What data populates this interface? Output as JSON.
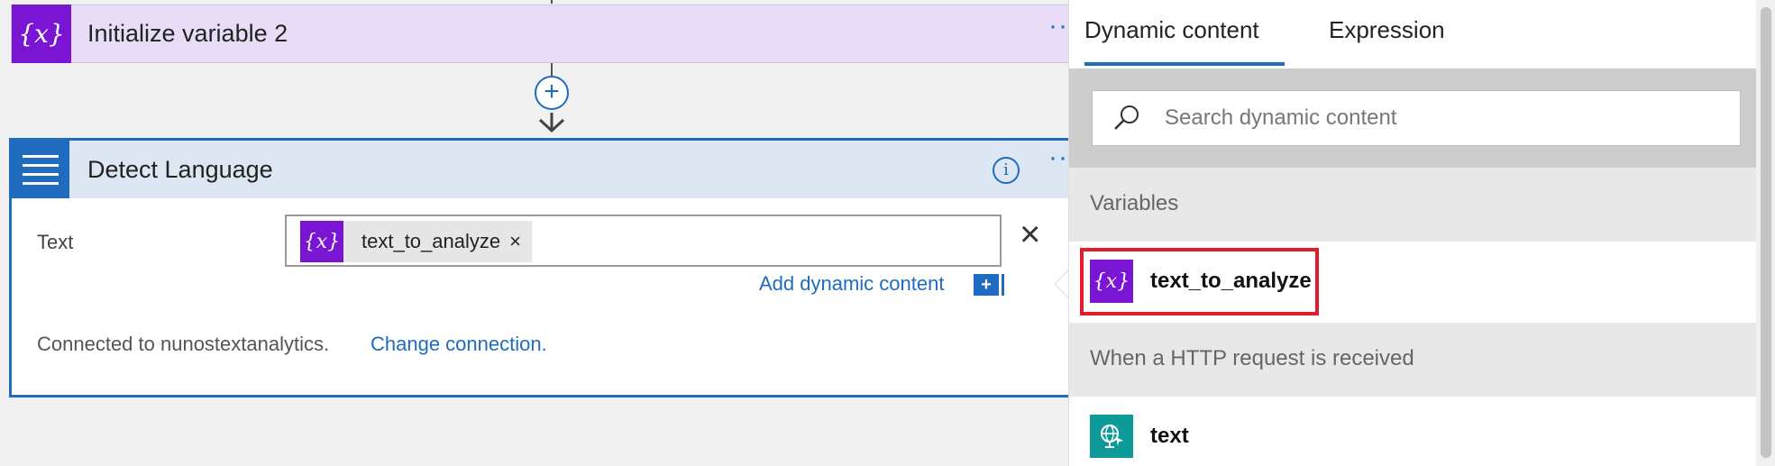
{
  "flow": {
    "init_card": {
      "title": "Initialize variable 2",
      "icon_glyph": "{x}",
      "icon": "variable-icon",
      "color": "#7a16d3"
    },
    "add_step_glyph": "+",
    "detect_card": {
      "title": "Detect Language",
      "icon": "text-analytics-icon",
      "color": "#1f6bbf",
      "info_glyph": "i",
      "more_glyph": "···",
      "text_label": "Text",
      "token": {
        "icon_glyph": "{x}",
        "label": "text_to_analyze",
        "remove_glyph": "×"
      },
      "clear_glyph": "×",
      "add_dynamic_label": "Add dynamic content",
      "add_dynamic_glyph": "+",
      "connection_text": "Connected to nunostextanalytics.",
      "change_connection_label": "Change connection."
    },
    "init_more_glyph": "···"
  },
  "panel": {
    "tabs": [
      {
        "label": "Dynamic content",
        "active": true
      },
      {
        "label": "Expression",
        "active": false
      }
    ],
    "search": {
      "placeholder": "Search dynamic content",
      "value": ""
    },
    "sections": [
      {
        "label": "Variables",
        "items": [
          {
            "label": "text_to_analyze",
            "icon": "variable-icon",
            "icon_glyph": "{x}",
            "highlighted": true
          }
        ]
      },
      {
        "label": "When a HTTP request is received",
        "items": [
          {
            "label": "text",
            "icon": "http-request-icon",
            "highlighted": false
          }
        ]
      }
    ]
  },
  "colors": {
    "accent": "#1f6bbf",
    "variable": "#7a16d3",
    "http": "#0f9a9a",
    "highlight": "#e11d2b"
  }
}
